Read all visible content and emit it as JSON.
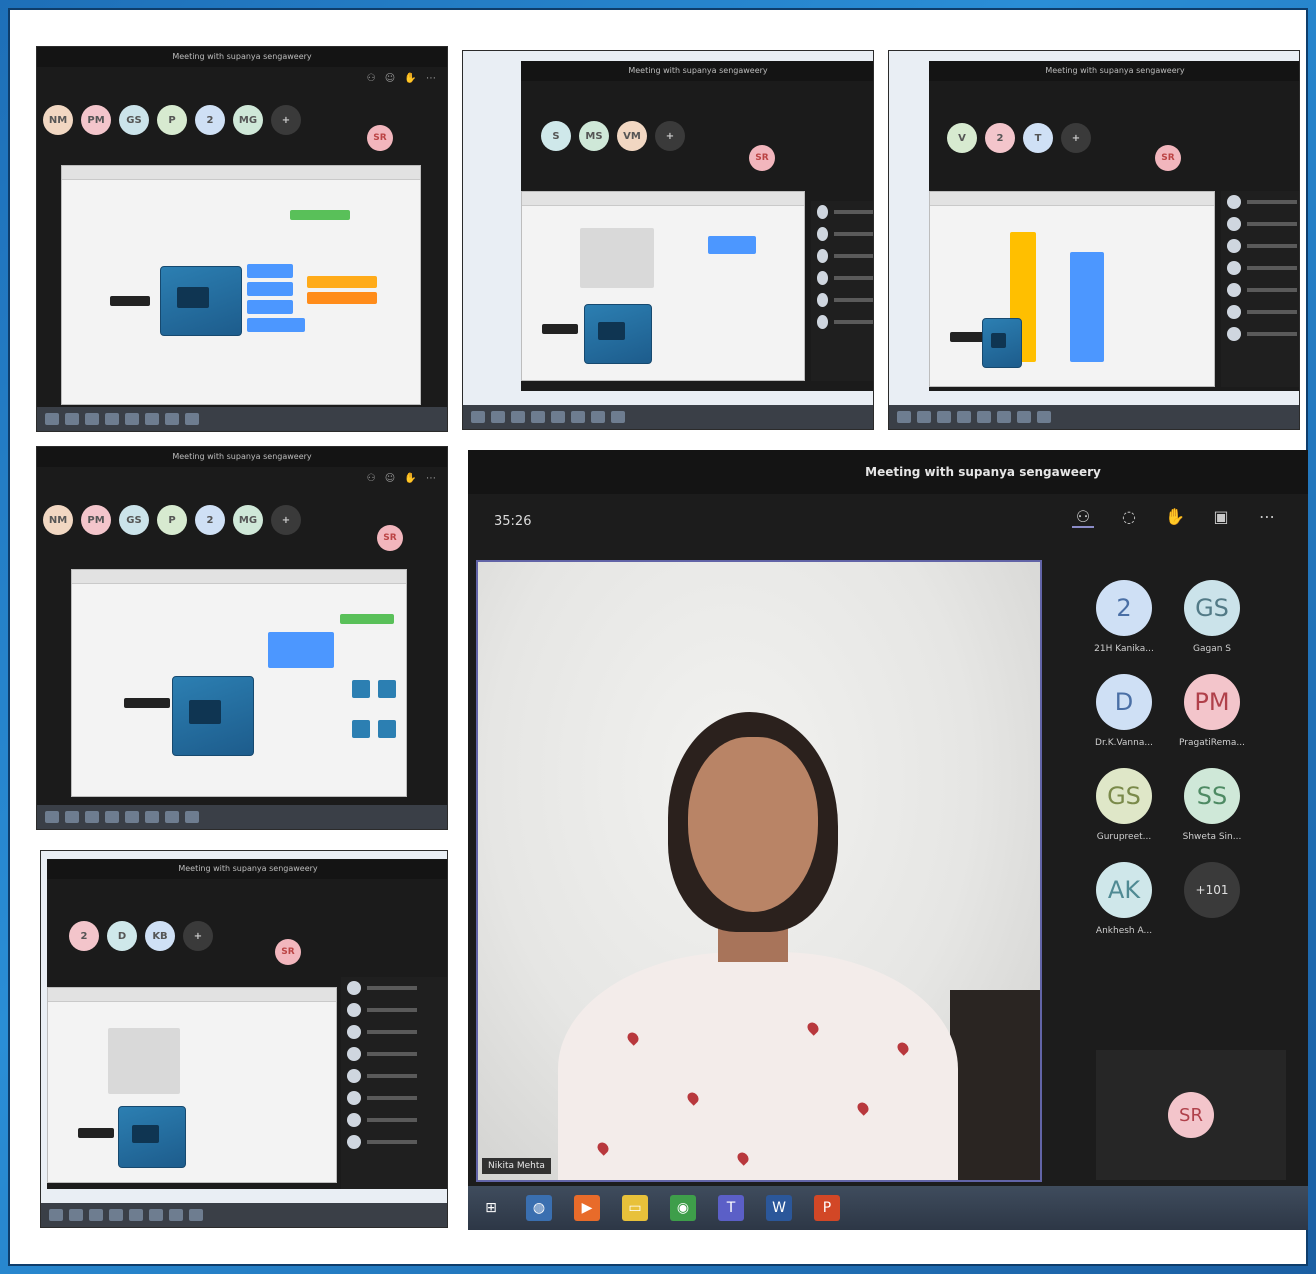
{
  "main_meeting": {
    "title": "Meeting with supanya sengaweery",
    "timer": "35:26",
    "toolbar": [
      "participants-icon",
      "chat-icon",
      "raise-hand-icon",
      "reactions-icon",
      "more-icon"
    ],
    "speaker_name": "Nikita Mehta",
    "participants": [
      {
        "initials": "2",
        "name": "21H Kanika...",
        "bg": "#cfe0f5",
        "fg": "#4a6fa5"
      },
      {
        "initials": "GS",
        "name": "Gagan S",
        "bg": "#cbe3ea",
        "fg": "#527a86"
      },
      {
        "initials": "D",
        "name": "Dr.K.Vanna...",
        "bg": "#cfe0f5",
        "fg": "#4a6fa5"
      },
      {
        "initials": "PM",
        "name": "PragatiRema...",
        "bg": "#f3c5cb",
        "fg": "#b0404a"
      },
      {
        "initials": "GS",
        "name": "Gurupreet...",
        "bg": "#dfe7c8",
        "fg": "#7a8a4a"
      },
      {
        "initials": "SS",
        "name": "Shweta Sin...",
        "bg": "#cfe8d8",
        "fg": "#4e8a63"
      },
      {
        "initials": "AK",
        "name": "Ankhesh A...",
        "bg": "#cfe7ea",
        "fg": "#4f8a93"
      }
    ],
    "more_count": "+101",
    "self_initials": "SR"
  },
  "thumbnails": {
    "t1": {
      "title": "Meeting with supanya sengaweery",
      "avatars": [
        "NM",
        "PM",
        "GS",
        "P",
        "2",
        "MG"
      ],
      "self": "SR"
    },
    "t2": {
      "title": "Meeting with supanya sengaweery",
      "avatars": [
        "S",
        "MS",
        "VM"
      ],
      "self": "SR"
    },
    "t3": {
      "title": "Meeting with supanya sengaweery",
      "avatars": [
        "V",
        "2",
        "T"
      ],
      "self": "SR"
    },
    "t4": {
      "title": "Meeting with supanya sengaweery",
      "avatars": [
        "NM",
        "PM",
        "GS",
        "P",
        "2",
        "MG"
      ],
      "self": "SR"
    },
    "t5": {
      "title": "Meeting with supanya sengaweery",
      "avatars": [
        "2",
        "D",
        "KB"
      ],
      "self": "SR"
    }
  },
  "colors": {
    "teams_accent": "#6264a7",
    "background": "#1e6fb8"
  }
}
